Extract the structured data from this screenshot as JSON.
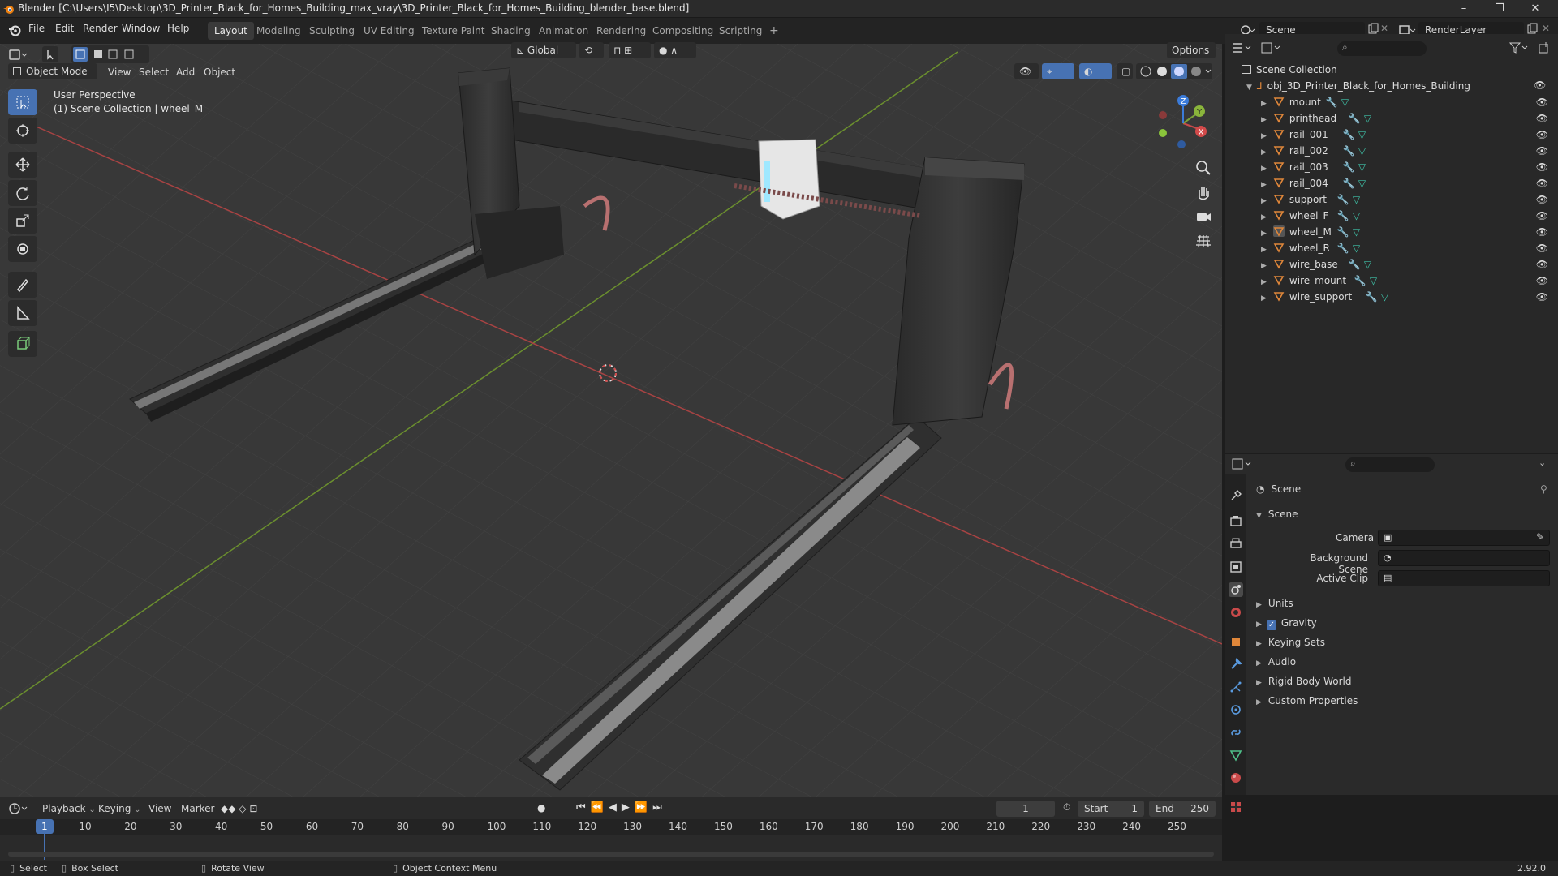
{
  "app": {
    "title": "Blender [C:\\Users\\I5\\Desktop\\3D_Printer_Black_for_Homes_Building_max_vray\\3D_Printer_Black_for_Homes_Building_blender_base.blend]",
    "version": "2.92.0",
    "logo_icon": "blender-logo-icon"
  },
  "menu": [
    "File",
    "Edit",
    "Render",
    "Window",
    "Help"
  ],
  "workspaces": [
    {
      "label": "Layout",
      "active": true
    },
    {
      "label": "Modeling",
      "active": false
    },
    {
      "label": "Sculpting",
      "active": false
    },
    {
      "label": "UV Editing",
      "active": false
    },
    {
      "label": "Texture Paint",
      "active": false
    },
    {
      "label": "Shading",
      "active": false
    },
    {
      "label": "Animation",
      "active": false
    },
    {
      "label": "Rendering",
      "active": false
    },
    {
      "label": "Compositing",
      "active": false
    },
    {
      "label": "Scripting",
      "active": false
    }
  ],
  "add_workspace": "+",
  "scene": {
    "label": "Scene",
    "render_layer": "RenderLayer"
  },
  "viewport": {
    "mode": "Object Mode",
    "header_menus": [
      "View",
      "Select",
      "Add",
      "Object"
    ],
    "orientation": "Global",
    "options": "Options",
    "overlay_line1": "User Perspective",
    "overlay_line2": "(1) Scene Collection | wheel_M",
    "gizmo_axes": [
      "X",
      "Y",
      "Z"
    ]
  },
  "outliner": {
    "root": "Scene Collection",
    "object": "obj_3D_Printer_Black_for_Homes_Building",
    "children": [
      "mount",
      "printhead",
      "rail_001",
      "rail_002",
      "rail_003",
      "rail_004",
      "support",
      "wheel_F",
      "wheel_M",
      "wheel_R",
      "wire_base",
      "wire_mount",
      "wire_support"
    ],
    "selected": "wheel_M"
  },
  "properties": {
    "context": "Scene",
    "section": "Scene",
    "fields": [
      {
        "label": "Camera"
      },
      {
        "label": "Background Scene"
      },
      {
        "label": "Active Clip"
      }
    ],
    "panels": [
      "Units",
      "Gravity",
      "Keying Sets",
      "Audio",
      "Rigid Body World",
      "Custom Properties"
    ],
    "gravity_checked": true
  },
  "timeline": {
    "menus": [
      "Playback",
      "Keying",
      "View",
      "Marker"
    ],
    "current_frame": "1",
    "start_label": "Start",
    "start": "1",
    "end_label": "End",
    "end": "250",
    "ticks": [
      "1",
      "10",
      "20",
      "30",
      "40",
      "50",
      "60",
      "70",
      "80",
      "90",
      "100",
      "110",
      "120",
      "130",
      "140",
      "150",
      "160",
      "170",
      "180",
      "190",
      "200",
      "210",
      "220",
      "230",
      "240",
      "250"
    ]
  },
  "statusbar": {
    "select": "Select",
    "box_select": "Box Select",
    "rotate": "Rotate View",
    "context": "Object Context Menu"
  },
  "colors": {
    "accent": "#4772b3",
    "x_axis": "#c84a4a",
    "y_axis": "#7aa23a",
    "z_axis": "#3b7bd9",
    "object_orange": "#e0873a",
    "outliner_green": "#3fc2a8"
  }
}
